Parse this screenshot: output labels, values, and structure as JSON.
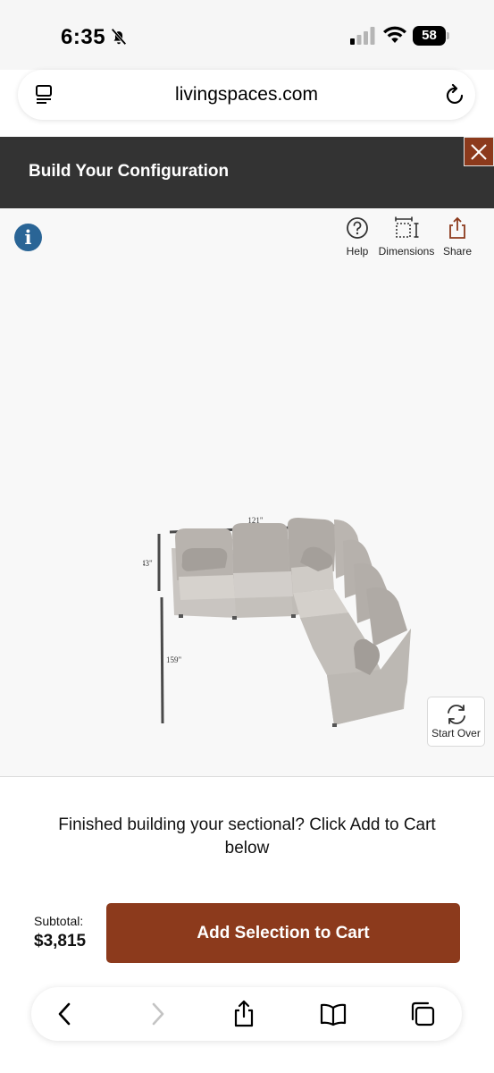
{
  "status_bar": {
    "time": "6:35",
    "battery": "58"
  },
  "browser": {
    "url": "livingspaces.com"
  },
  "header": {
    "title": "Build Your Configuration"
  },
  "toolbar": {
    "help_label": "Help",
    "dimensions_label": "Dimensions",
    "share_label": "Share"
  },
  "viewer": {
    "info_symbol": "i",
    "dimension_top": "121\"",
    "dimension_left": "43\"",
    "dimension_depth": "159\"",
    "start_over_label": "Start Over"
  },
  "message": "Finished building your sectional? Click Add to Cart below",
  "cart": {
    "subtotal_label": "Subtotal:",
    "subtotal_value": "$3,815",
    "add_button_label": "Add Selection to Cart"
  },
  "colors": {
    "accent": "#8c3a1c",
    "header_bg": "#333333",
    "info_blue": "#2a6596"
  },
  "icons": {
    "status": [
      "bell-slash-icon",
      "signal-icon",
      "wifi-icon",
      "battery-icon"
    ],
    "browser": [
      "tab-overview-icon",
      "reload-icon"
    ],
    "tools": [
      "help-icon",
      "dimensions-icon",
      "share-icon"
    ],
    "bottom_nav": [
      "back-icon",
      "forward-icon",
      "share-icon",
      "bookmarks-icon",
      "tabs-icon"
    ]
  }
}
